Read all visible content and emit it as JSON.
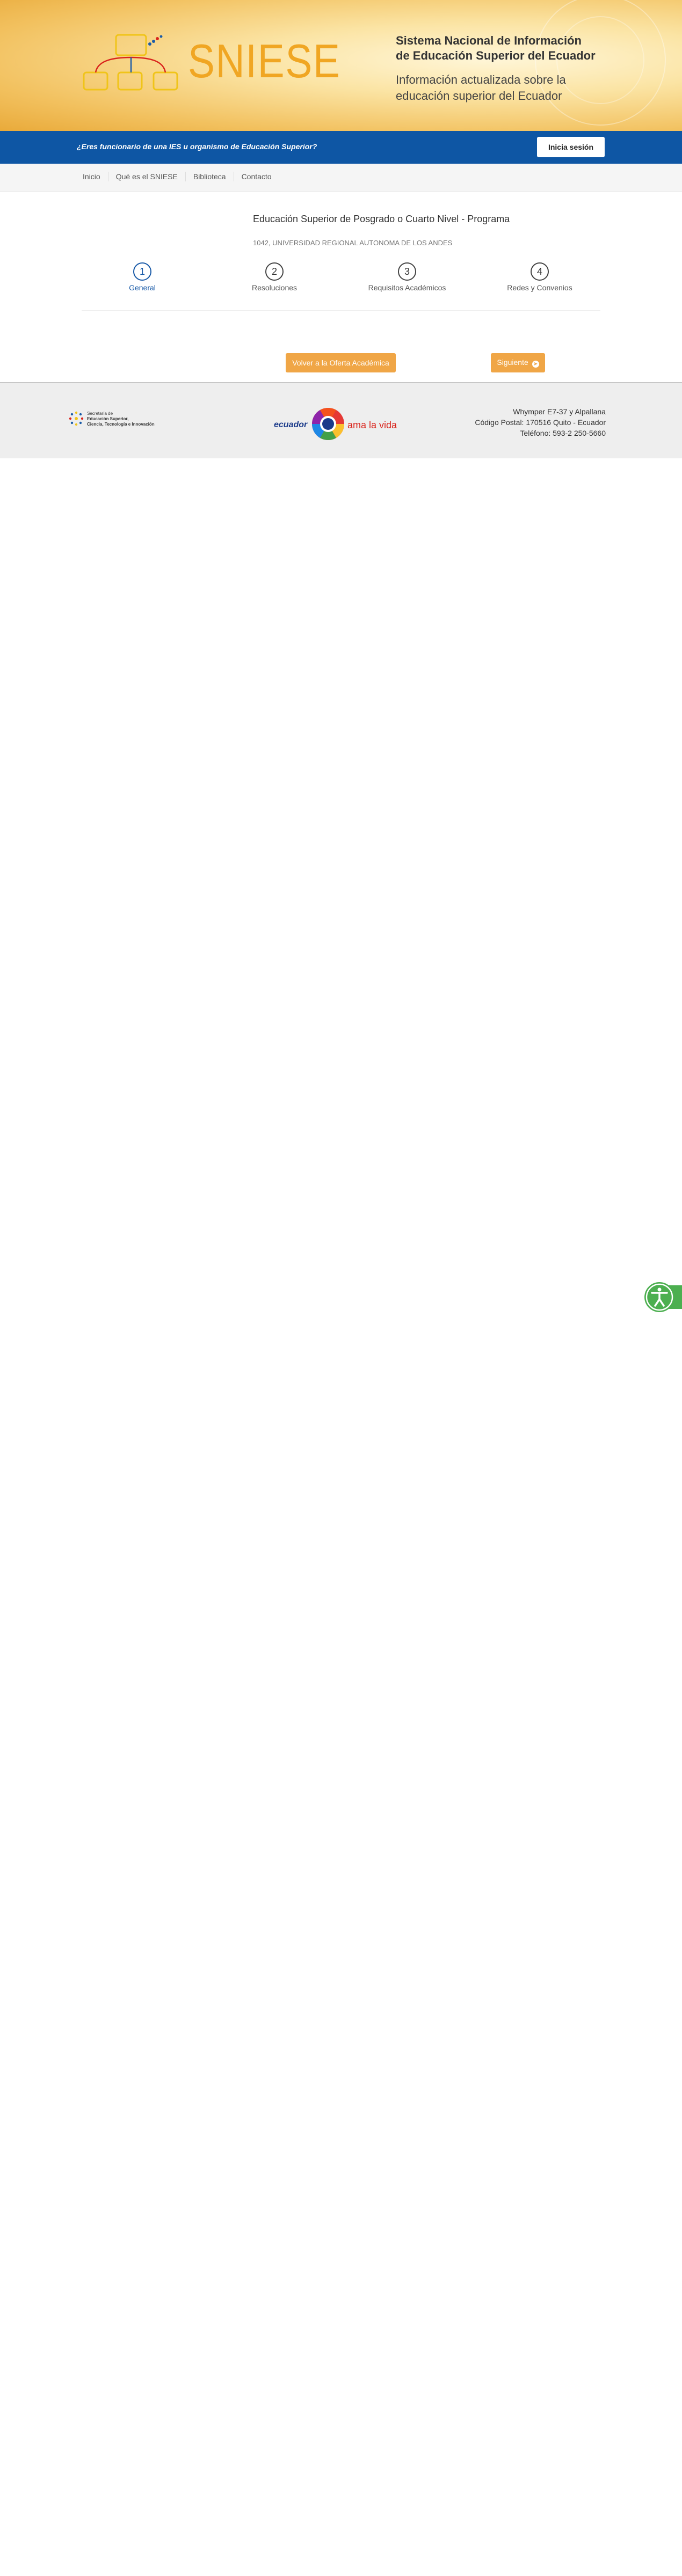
{
  "header": {
    "logo_text": "SNIESE",
    "site_title_line1": "Sistema Nacional de Información",
    "site_title_line2": "de Educación Superior del Ecuador",
    "site_subtitle": "Información actualizada sobre la educación superior del Ecuador"
  },
  "topbar": {
    "question": "¿Eres funcionario de una IES u organismo de Educación Superior?",
    "login_label": "Inicia sesión"
  },
  "nav": {
    "items": [
      {
        "label": "Inicio"
      },
      {
        "label": "Qué es el SNIESE"
      },
      {
        "label": "Biblioteca"
      },
      {
        "label": "Contacto"
      }
    ]
  },
  "program": {
    "title": "Educación Superior de Posgrado o Cuarto Nivel - Programa",
    "institution": "1042, UNIVERSIDAD REGIONAL AUTONOMA DE LOS ANDES"
  },
  "steps": [
    {
      "number": "1",
      "label": "General",
      "active": true
    },
    {
      "number": "2",
      "label": "Resoluciones",
      "active": false
    },
    {
      "number": "3",
      "label": "Requisitos Académicos",
      "active": false
    },
    {
      "number": "4",
      "label": "Redes y Convenios",
      "active": false
    }
  ],
  "actions": {
    "back_label": "Volver a la Oferta Académica",
    "next_label": "Siguiente"
  },
  "footer": {
    "senescyt_line1": "Secretaría de",
    "senescyt_line2": "Educación Superior,",
    "senescyt_line3": "Ciencia, Tecnología e Innovación",
    "ecuador_word": "ecuador",
    "ama_la_vida": "ama la vida",
    "address_line1": "Whymper E7-37 y Alpallana",
    "address_line2": "Código Postal: 170516 Quito - Ecuador",
    "address_line3": "Teléfono: 593-2 250-5660"
  },
  "colors": {
    "brand_orange": "#f0a646",
    "brand_blue": "#0e56a4",
    "active_step": "#1a5ba8"
  },
  "icons": {
    "accessibility": "accessibility-icon",
    "next": "arrow-circle-right-icon"
  }
}
